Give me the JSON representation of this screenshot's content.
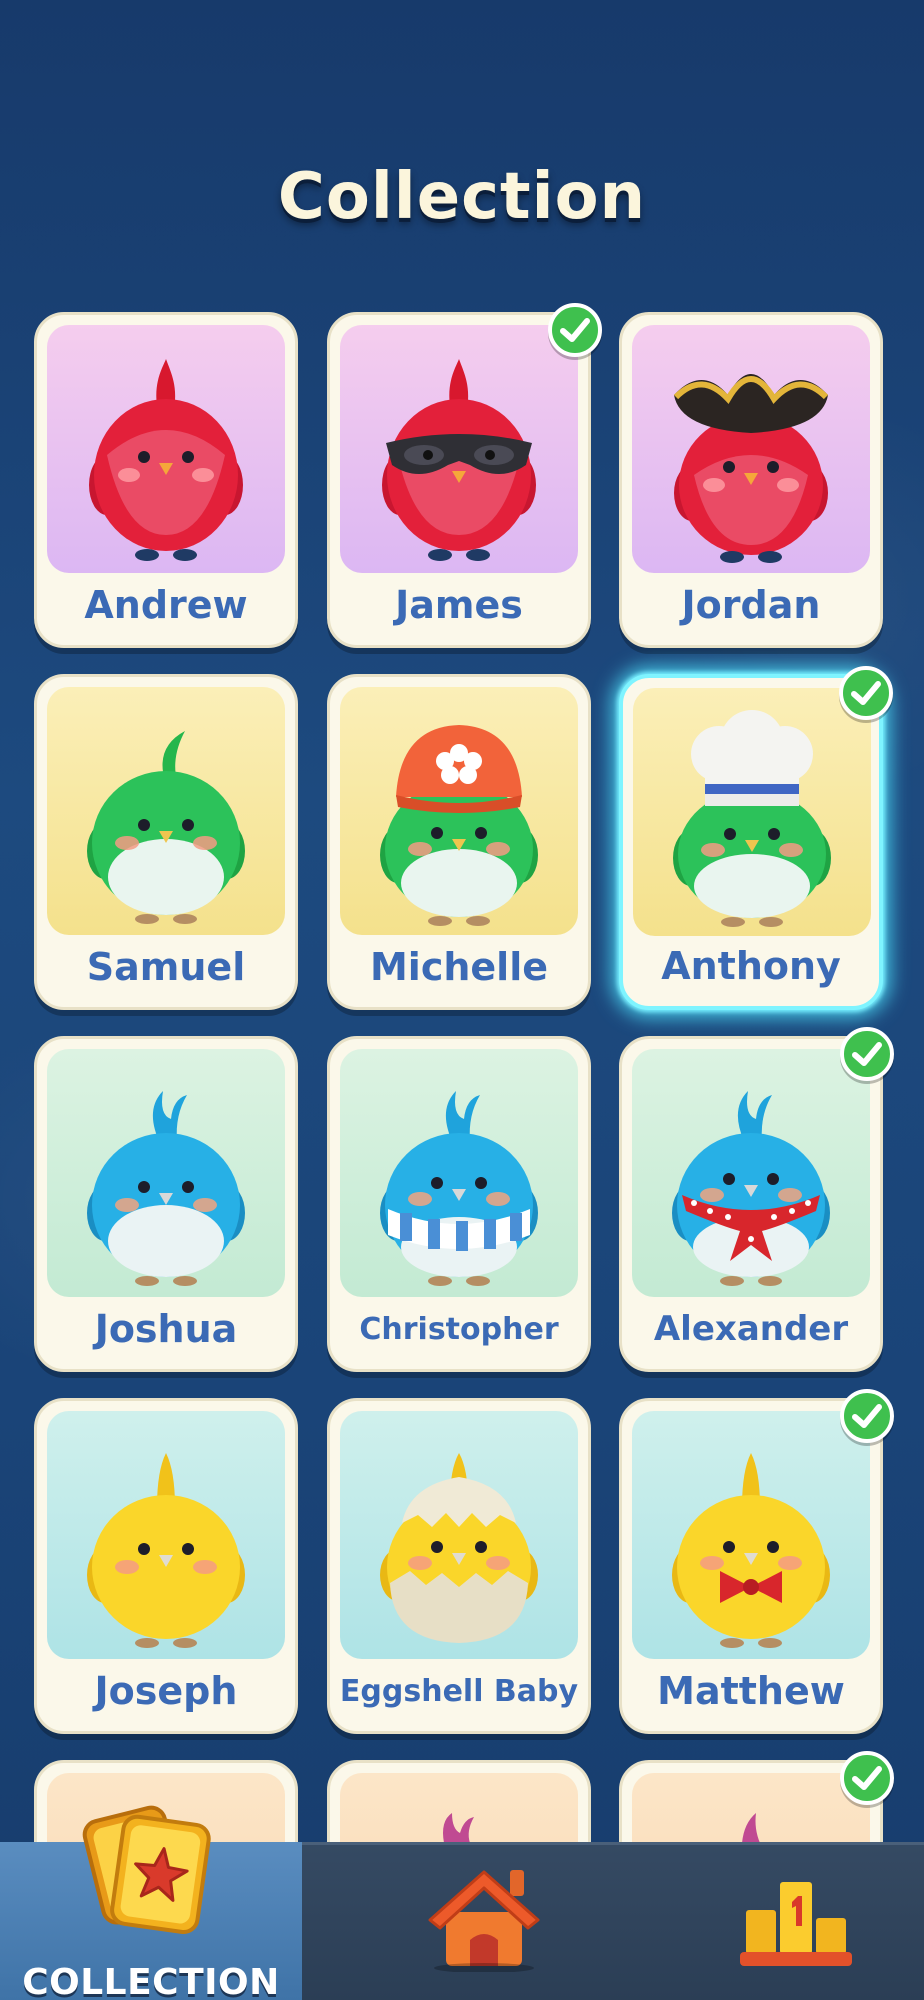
{
  "header": {
    "title": "Collection"
  },
  "colors": {
    "accent": "#3b6ab5",
    "check": "#3fc04e",
    "selected_glow": "#7ff4ff"
  },
  "characters": [
    {
      "name": "Andrew",
      "owned": false,
      "selected": false,
      "bird_color": "red",
      "accessory": "none"
    },
    {
      "name": "James",
      "owned": true,
      "selected": false,
      "bird_color": "red",
      "accessory": "mask"
    },
    {
      "name": "Jordan",
      "owned": false,
      "selected": false,
      "bird_color": "red",
      "accessory": "pirate-hat"
    },
    {
      "name": "Samuel",
      "owned": false,
      "selected": false,
      "bird_color": "green",
      "accessory": "tuft"
    },
    {
      "name": "Michelle",
      "owned": false,
      "selected": false,
      "bird_color": "green",
      "accessory": "cap"
    },
    {
      "name": "Anthony",
      "owned": true,
      "selected": true,
      "bird_color": "green",
      "accessory": "chef-hat"
    },
    {
      "name": "Joshua",
      "owned": false,
      "selected": false,
      "bird_color": "blue",
      "accessory": "none"
    },
    {
      "name": "Christopher",
      "owned": false,
      "selected": false,
      "bird_color": "blue",
      "accessory": "scarf"
    },
    {
      "name": "Alexander",
      "owned": true,
      "selected": false,
      "bird_color": "blue",
      "accessory": "bandana"
    },
    {
      "name": "Joseph",
      "owned": false,
      "selected": false,
      "bird_color": "yellow",
      "accessory": "none"
    },
    {
      "name": "Eggshell Baby",
      "owned": false,
      "selected": false,
      "bird_color": "yellow",
      "accessory": "eggshell"
    },
    {
      "name": "Matthew",
      "owned": true,
      "selected": false,
      "bird_color": "yellow",
      "accessory": "bowtie"
    },
    {
      "name": "",
      "owned": false,
      "selected": false,
      "bird_color": "pink",
      "accessory": "partial"
    },
    {
      "name": "",
      "owned": false,
      "selected": false,
      "bird_color": "pink",
      "accessory": "partial"
    },
    {
      "name": "",
      "owned": true,
      "selected": false,
      "bird_color": "pink",
      "accessory": "partial"
    }
  ],
  "nav": {
    "collection_label": "COLLECTION",
    "collection_icon": "card-star-icon",
    "home_icon": "house-icon",
    "leaderboard_icon": "podium-icon"
  }
}
